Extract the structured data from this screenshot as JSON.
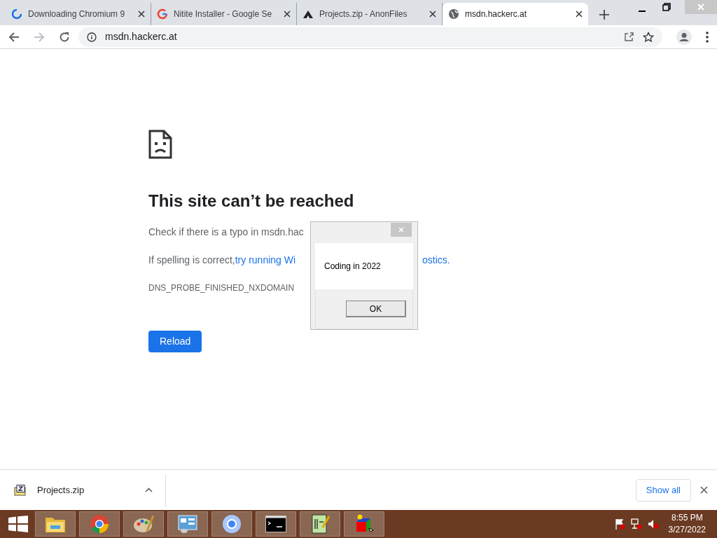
{
  "tabs": [
    {
      "title": "Downloading Chromium 9",
      "kind": "spinner",
      "selected": false
    },
    {
      "title": "Nitite Installer - Google Se",
      "kind": "google",
      "selected": false
    },
    {
      "title": "Projects.zip - AnonFiles",
      "kind": "anon",
      "selected": false
    },
    {
      "title": "msdn.hackerc.at",
      "kind": "globe",
      "selected": true
    }
  ],
  "address_bar": {
    "url": "msdn.hackerc.at"
  },
  "error_page": {
    "heading": "This site can’t be reached",
    "line_1": "Check if there is a typo in msdn.hac",
    "line_2_prefix": "If spelling is correct, ",
    "line_2_link": "try running Wi",
    "line_2_suffix": "ostics.",
    "error_code": "DNS_PROBE_FINISHED_NXDOMAIN",
    "reload_button": "Reload"
  },
  "dialog": {
    "message": "Coding in 2022",
    "ok_button": "OK"
  },
  "download_bar": {
    "file": "Projects.zip",
    "show_all": "Show all"
  },
  "taskbar": {
    "apps": [
      {
        "kind": "folder"
      },
      {
        "kind": "chrome"
      },
      {
        "kind": "paint"
      },
      {
        "kind": "control"
      },
      {
        "kind": "chromium"
      },
      {
        "kind": "cmd"
      },
      {
        "kind": "notepad"
      },
      {
        "kind": "cube"
      }
    ],
    "time": "8:55 PM",
    "date": "3/27/2022"
  }
}
